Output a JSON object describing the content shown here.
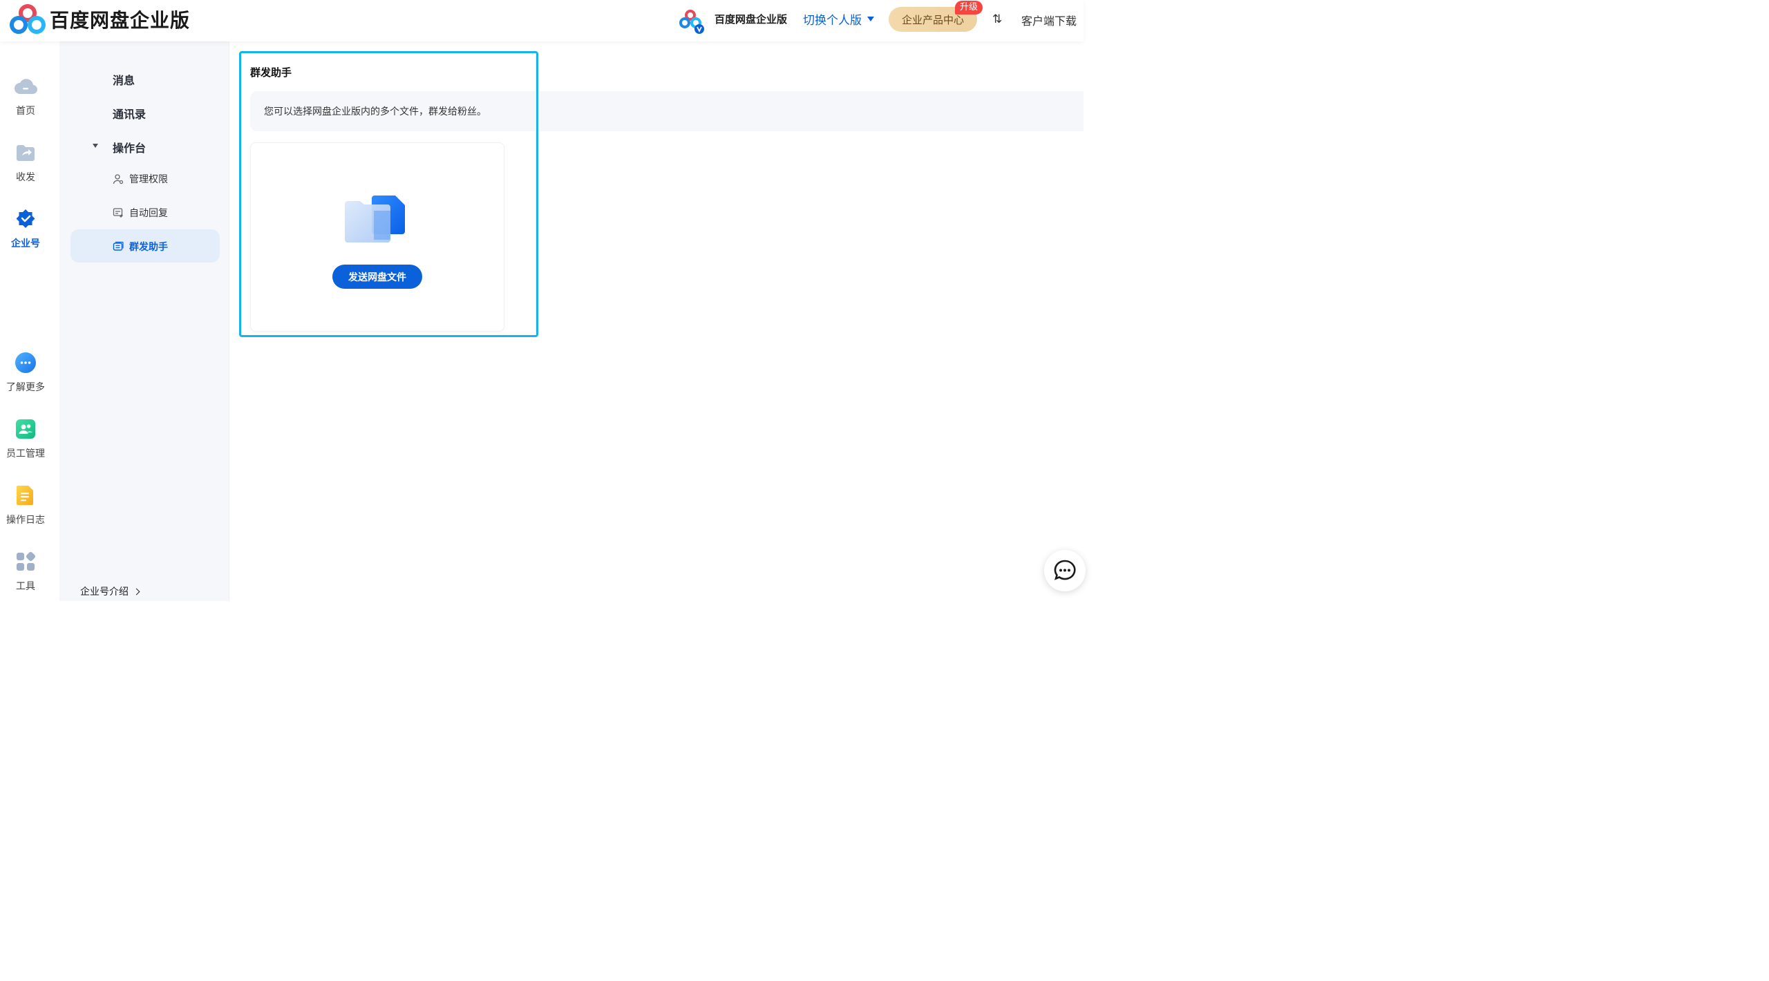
{
  "header": {
    "brand": "百度网盘企业版",
    "product_label": "百度网盘企业版",
    "switch_label": "切换个人版",
    "center_label": "企业产品中心",
    "upgrade_badge": "升级",
    "sort_glyph": "⇅",
    "download_label": "客户端下载"
  },
  "rail": {
    "items": [
      {
        "label": "首页",
        "icon": "cloud-icon"
      },
      {
        "label": "收发",
        "icon": "share-folder-icon"
      },
      {
        "label": "企业号",
        "icon": "verified-badge-icon"
      },
      {
        "label": "了解更多",
        "icon": "more-dots-icon"
      },
      {
        "label": "员工管理",
        "icon": "people-icon"
      },
      {
        "label": "操作日志",
        "icon": "log-doc-icon"
      },
      {
        "label": "工具",
        "icon": "apps-grid-icon"
      }
    ]
  },
  "subnav": {
    "items": [
      "消息",
      "通讯录",
      "操作台"
    ],
    "sub_items": [
      "管理权限",
      "自动回复",
      "群发助手"
    ],
    "intro_link": "企业号介绍"
  },
  "main": {
    "title": "群发助手",
    "info": "您可以选择网盘企业版内的多个文件，群发给粉丝。",
    "send_button": "发送网盘文件"
  },
  "colors": {
    "accent": "#0b61d9",
    "focus": "#19b3ec",
    "upgrade": "#f6453e"
  }
}
